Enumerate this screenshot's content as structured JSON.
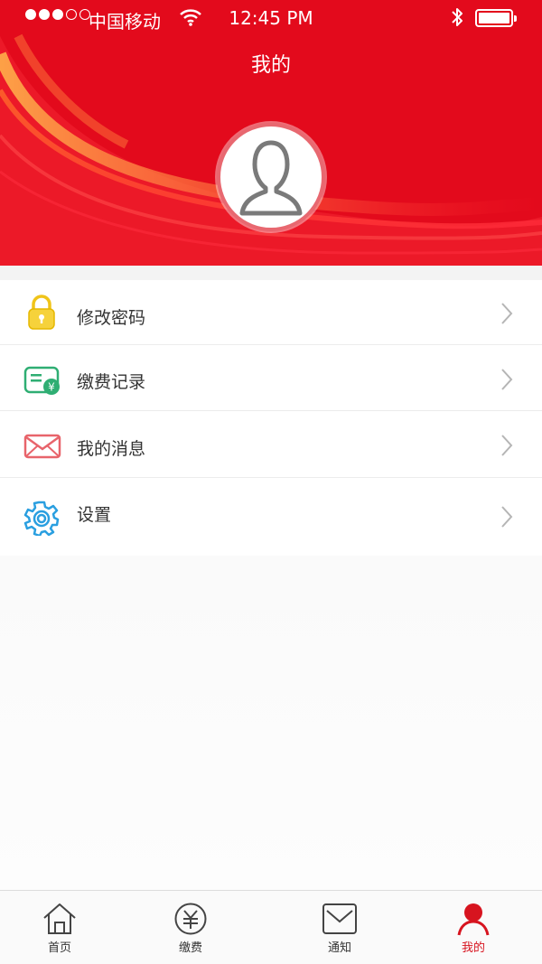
{
  "status_bar": {
    "carrier": "中国移动",
    "time": "12:45 PM"
  },
  "header": {
    "title": "我的"
  },
  "menu": {
    "items": [
      {
        "label": "修改密码",
        "icon": "lock-icon"
      },
      {
        "label": "缴费记录",
        "icon": "payment-record-icon"
      },
      {
        "label": "我的消息",
        "icon": "envelope-icon"
      },
      {
        "label": "设置",
        "icon": "gear-icon"
      }
    ]
  },
  "tabbar": {
    "tabs": [
      {
        "label": "首页",
        "icon": "home-icon"
      },
      {
        "label": "缴费",
        "icon": "yen-icon"
      },
      {
        "label": "通知",
        "icon": "mail-icon"
      },
      {
        "label": "我的",
        "icon": "user-icon",
        "active": true
      }
    ]
  },
  "colors": {
    "header_red": "#e30a1c",
    "active_tab": "#d7141f"
  }
}
